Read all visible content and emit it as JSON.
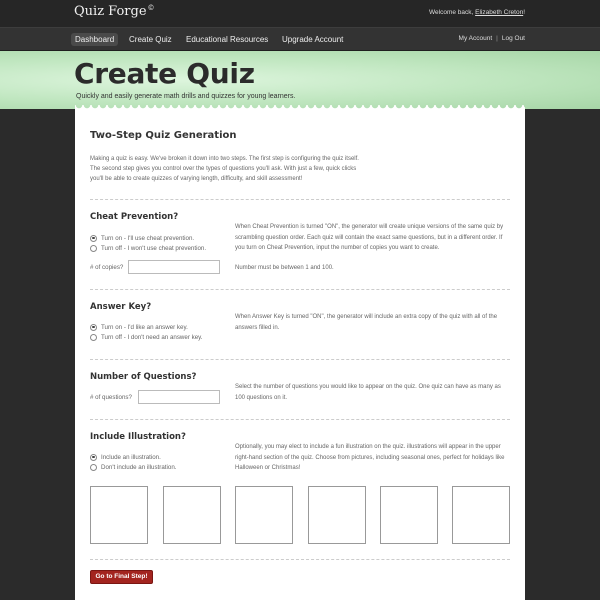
{
  "header": {
    "logo": "Quiz Forge",
    "logo_mark": "©",
    "welcome_prefix": "Welcome back, ",
    "user_name": "Elizabeth Creton",
    "welcome_suffix": "!"
  },
  "nav": {
    "items": [
      {
        "label": "Dashboard",
        "active": true
      },
      {
        "label": "Create Quiz",
        "active": false
      },
      {
        "label": "Educational Resources",
        "active": false
      },
      {
        "label": "Upgrade Account",
        "active": false
      }
    ],
    "my_account": "My Account",
    "separator": "|",
    "logout": "Log Out"
  },
  "banner": {
    "title": "Create Quiz",
    "subtitle": "Quickly and easily generate math drills and quizzes for young learners."
  },
  "intro": {
    "title": "Two-Step Quiz Generation",
    "body": "Making a quiz is easy. We've broken it down into two steps. The first step is configuring the quiz itself. The second step gives you control over the types of questions you'll ask. With just a few, quick clicks you'll be able to create quizzes of varying length, difficulty, and skill assessment!"
  },
  "cheat_prevention": {
    "title": "Cheat Prevention?",
    "option_on": "Turn on - I'll use cheat prevention.",
    "option_off": "Turn off - I won't use cheat prevention.",
    "selected": "on",
    "copies_label": "# of copies?",
    "copies_value": "",
    "description": "When Cheat Prevention is turned \"ON\", the generator will create unique versions of the same quiz by scrambling question order. Each quiz will contain the exact same questions, but in a different order. If you turn on Cheat Prevention, input the number of copies you want to create.",
    "note": "Number must be between 1 and 100."
  },
  "answer_key": {
    "title": "Answer Key?",
    "option_on": "Turn on - I'd like an answer key.",
    "option_off": "Turn off - I don't need an answer key.",
    "selected": "on",
    "description": "When Answer Key is turned \"ON\", the generator will include an extra copy of the quiz with all of the answers filled in."
  },
  "num_questions": {
    "title": "Number of Questions?",
    "label": "# of questions?",
    "value": "",
    "description": "Select the number of questions you would like to appear on the quiz. One quiz can have as many as 100 questions on it."
  },
  "illustration": {
    "title": "Include Illustration?",
    "option_on": "Include an illustration.",
    "option_off": "Don't include an illustration.",
    "selected": "on",
    "description": "Optionally, you may elect to include a fun illustration on the quiz. illustrations will appear in the upper right-hand section of the quiz. Choose from pictures, including seasonal ones, perfect for holidays like Halloween or Christmas!",
    "thumbnail_count": 6
  },
  "actions": {
    "final_step": "Go to Final Step!"
  },
  "colors": {
    "page_bg": "#2b2b2b",
    "banner": "#bfe6bf",
    "primary_button": "#a3241f"
  }
}
